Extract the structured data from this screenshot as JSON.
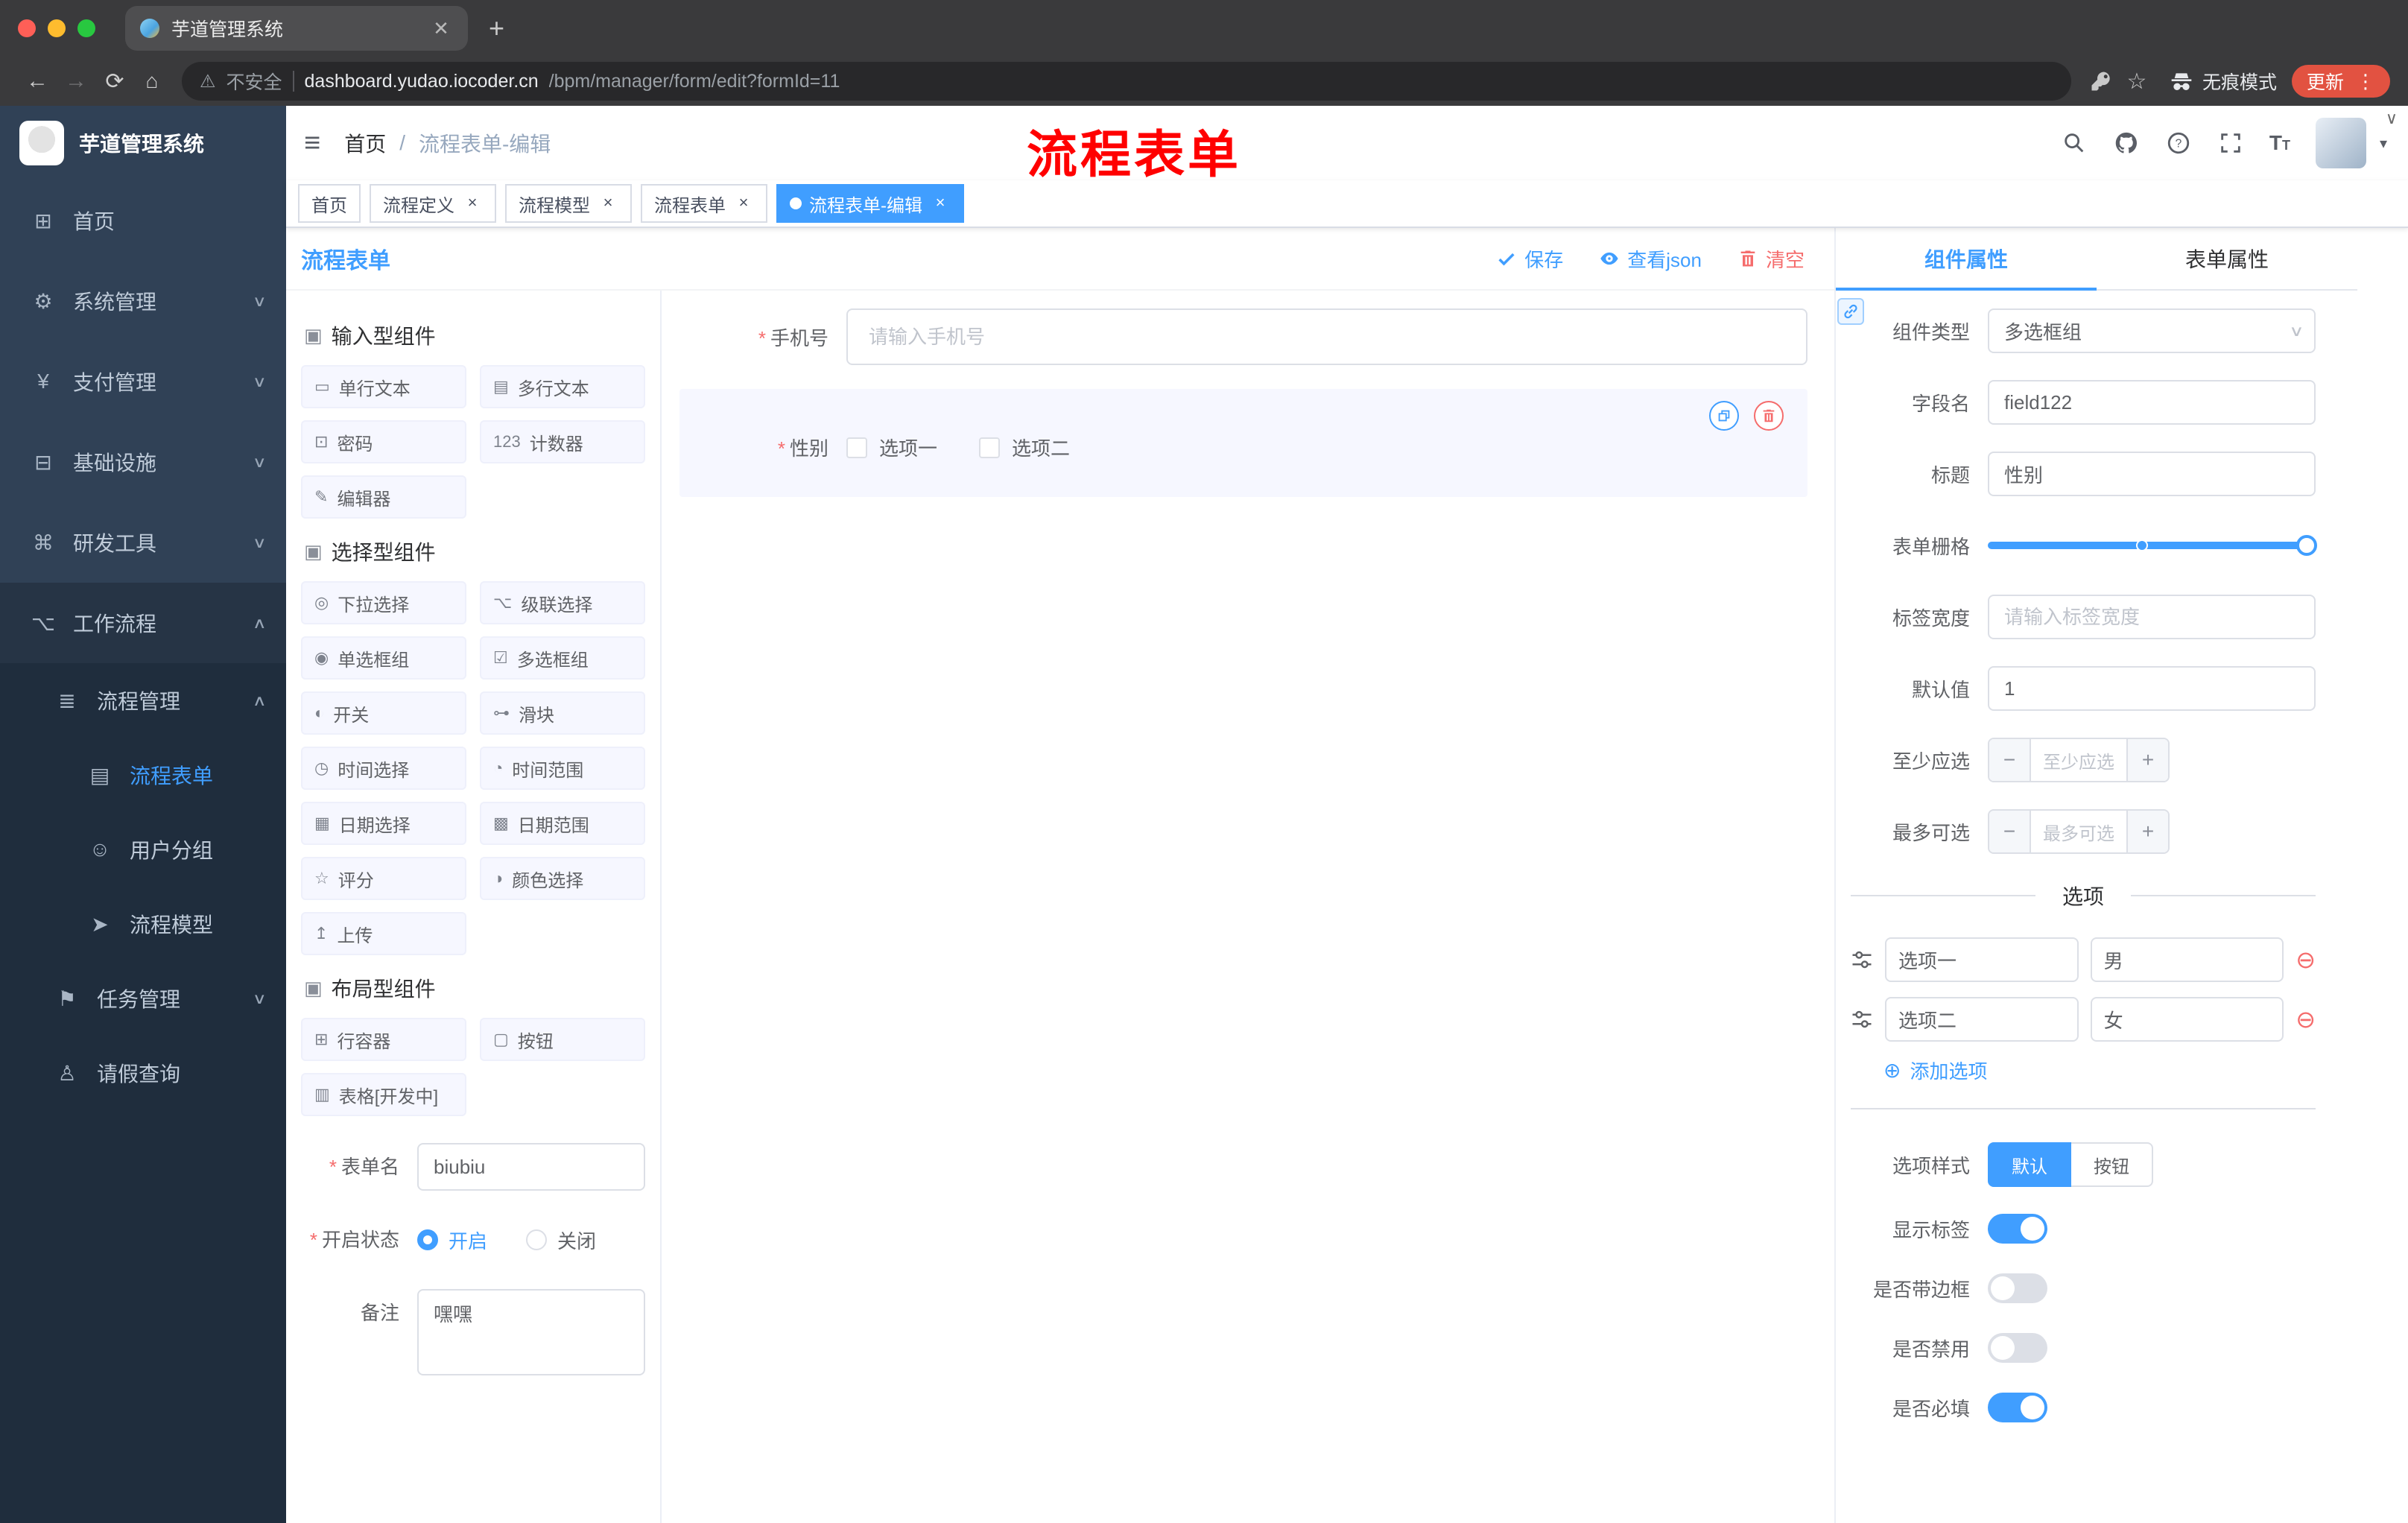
{
  "colors": {
    "primary": "#409eff",
    "danger": "#f56c6c",
    "sidebar": "#304156",
    "submenu": "#1f2d3d",
    "active_tag": "#409eff",
    "annotation": "#ff0000",
    "update_button": "#e25241"
  },
  "browser": {
    "tab_title": "芋道管理系统",
    "security_label": "不安全",
    "url_host": "dashboard.yudao.iocoder.cn",
    "url_path": "/bpm/manager/form/edit?formId=11",
    "incognito_label": "无痕模式",
    "update_label": "更新"
  },
  "sidebar": {
    "logo_title": "芋道管理系统",
    "items": [
      {
        "label": "首页",
        "glyph": "⊞"
      },
      {
        "label": "系统管理",
        "glyph": "⚙"
      },
      {
        "label": "支付管理",
        "glyph": "¥"
      },
      {
        "label": "基础设施",
        "glyph": "⊟"
      },
      {
        "label": "研发工具",
        "glyph": "⌘"
      },
      {
        "label": "工作流程",
        "glyph": "⌥"
      }
    ],
    "workflow_children": [
      {
        "label": "流程管理",
        "glyph": "≣"
      },
      {
        "label": "任务管理",
        "glyph": "⚑"
      },
      {
        "label": "请假查询",
        "glyph": "♙"
      }
    ],
    "process_children": [
      {
        "label": "流程表单",
        "glyph": "▤"
      },
      {
        "label": "用户分组",
        "glyph": "☺"
      },
      {
        "label": "流程模型",
        "glyph": "➤"
      }
    ]
  },
  "header": {
    "breadcrumb_home": "首页",
    "breadcrumb_current": "流程表单-编辑",
    "annotation": "流程表单"
  },
  "tags": [
    {
      "label": "首页"
    },
    {
      "label": "流程定义"
    },
    {
      "label": "流程模型"
    },
    {
      "label": "流程表单"
    },
    {
      "label": "流程表单-编辑"
    }
  ],
  "toolbar": {
    "title": "流程表单",
    "save_label": "保存",
    "view_json_label": "查看json",
    "clear_label": "清空"
  },
  "components_panel": {
    "groups": [
      {
        "title": "输入型组件",
        "items": [
          {
            "label": "单行文本",
            "glyph": "▭"
          },
          {
            "label": "多行文本",
            "glyph": "▤"
          },
          {
            "label": "密码",
            "glyph": "⊡"
          },
          {
            "label": "计数器",
            "glyph": "123"
          },
          {
            "label": "编辑器",
            "glyph": "✎"
          }
        ]
      },
      {
        "title": "选择型组件",
        "items": [
          {
            "label": "下拉选择",
            "glyph": "◎"
          },
          {
            "label": "级联选择",
            "glyph": "⌥"
          },
          {
            "label": "单选框组",
            "glyph": "◉"
          },
          {
            "label": "多选框组",
            "glyph": "☑"
          },
          {
            "label": "开关",
            "glyph": "◐"
          },
          {
            "label": "滑块",
            "glyph": "⊶"
          },
          {
            "label": "时间选择",
            "glyph": "◷"
          },
          {
            "label": "时间范围",
            "glyph": "◔"
          },
          {
            "label": "日期选择",
            "glyph": "▦"
          },
          {
            "label": "日期范围",
            "glyph": "▩"
          },
          {
            "label": "评分",
            "glyph": "☆"
          },
          {
            "label": "颜色选择",
            "glyph": "◑"
          },
          {
            "label": "上传",
            "glyph": "↥"
          }
        ]
      },
      {
        "title": "布局型组件",
        "items": [
          {
            "label": "行容器",
            "glyph": "⊞"
          },
          {
            "label": "按钮",
            "glyph": "▢"
          },
          {
            "label": "表格[开发中]",
            "glyph": "▥"
          }
        ]
      }
    ]
  },
  "form_meta": {
    "name_label": "表单名",
    "name_value": "biubiu",
    "status_label": "开启状态",
    "status_on": "开启",
    "status_off": "关闭",
    "status_selected": "开启",
    "remark_label": "备注",
    "remark_value": "嘿嘿"
  },
  "canvas": {
    "phone": {
      "label": "手机号",
      "placeholder": "请输入手机号"
    },
    "gender": {
      "label": "性别",
      "options": [
        "选项一",
        "选项二"
      ]
    }
  },
  "properties": {
    "tabs": [
      "组件属性",
      "表单属性"
    ],
    "active_tab": "组件属性",
    "component_type": {
      "label": "组件类型",
      "value": "多选框组"
    },
    "field_name": {
      "label": "字段名",
      "value": "field122"
    },
    "title_field": {
      "label": "标题",
      "value": "性别"
    },
    "grid": {
      "label": "表单栅格"
    },
    "label_width": {
      "label": "标签宽度",
      "placeholder": "请输入标签宽度"
    },
    "default_value": {
      "label": "默认值",
      "value": "1"
    },
    "min_select": {
      "label": "至少应选",
      "placeholder": "至少应选"
    },
    "max_select": {
      "label": "最多可选",
      "placeholder": "最多可选"
    },
    "options_title": "选项",
    "options": [
      {
        "label": "选项一",
        "value": "男"
      },
      {
        "label": "选项二",
        "value": "女"
      }
    ],
    "add_option_label": "添加选项",
    "option_style": {
      "label": "选项样式",
      "options": [
        "默认",
        "按钮"
      ],
      "selected": "默认"
    },
    "switches": [
      {
        "label": "显示标签",
        "on": true
      },
      {
        "label": "是否带边框",
        "on": false
      },
      {
        "label": "是否禁用",
        "on": false
      },
      {
        "label": "是否必填",
        "on": true
      }
    ]
  }
}
